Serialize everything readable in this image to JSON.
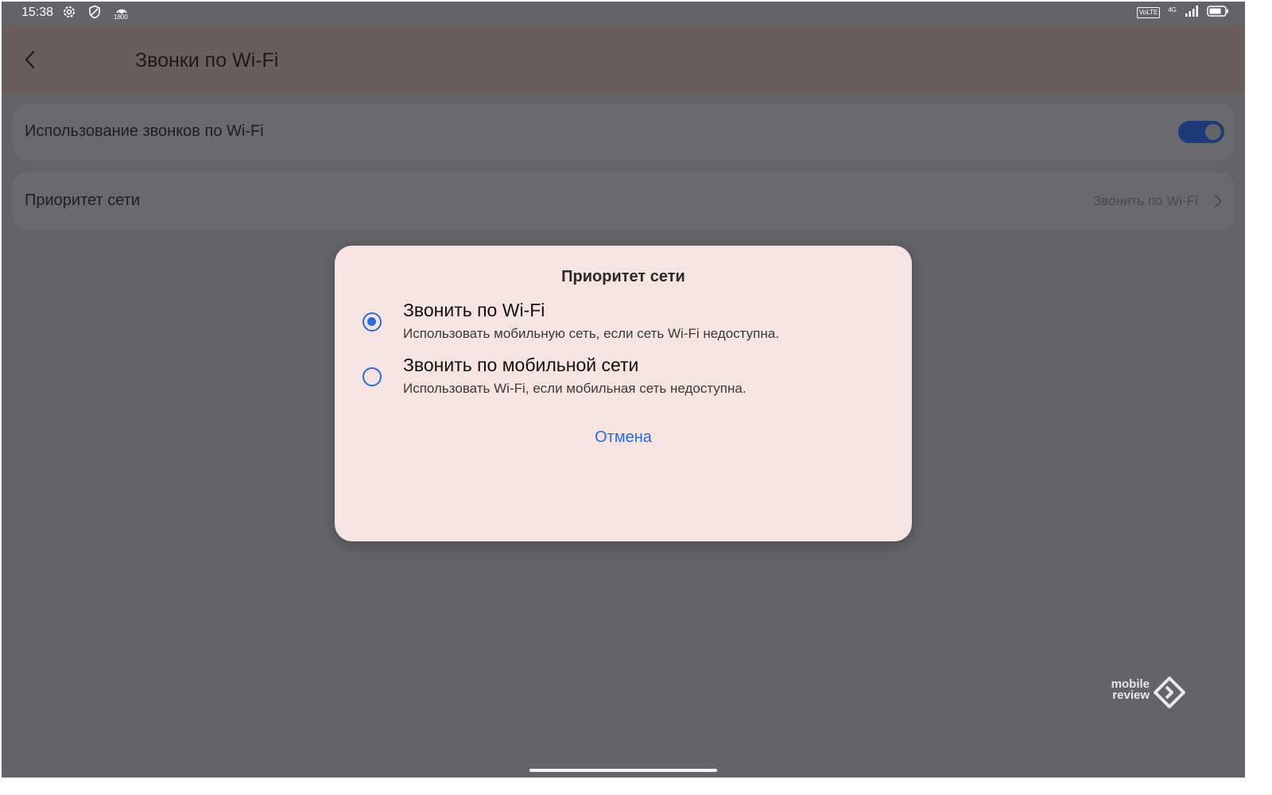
{
  "status_bar": {
    "time": "15:38",
    "left_icons": [
      "gear-icon",
      "shield-icon",
      "hotspot-icon"
    ],
    "hotspot_label": "1800",
    "volte": "VoLTE",
    "network": "4G",
    "right_icons": [
      "signal-icon",
      "battery-icon"
    ]
  },
  "app_bar": {
    "title": "Звонки по Wi-Fi",
    "back_icon": "back-arrow-icon"
  },
  "settings": {
    "wifi_calling": {
      "label": "Использование звонков по Wi-Fi",
      "enabled": true
    },
    "network_priority": {
      "label": "Приоритет сети",
      "value": "Звонить по Wi-Fi"
    }
  },
  "dialog": {
    "title": "Приоритет сети",
    "options": [
      {
        "title": "Звонить по Wi-Fi",
        "subtitle": "Использовать мобильную сеть, если сеть Wi-Fi недоступна.",
        "selected": true
      },
      {
        "title": "Звонить по мобильной сети",
        "subtitle": "Использовать Wi-Fi, если мобильная сеть недоступна.",
        "selected": false
      }
    ],
    "cancel": "Отмена"
  },
  "watermark": {
    "line1": "mobile",
    "line2": "review"
  },
  "colors": {
    "accent": "#2a6bd9",
    "dialog_bg": "#f6e4e2",
    "scrim": "#646368",
    "toggle_on": "#1f3a78"
  }
}
